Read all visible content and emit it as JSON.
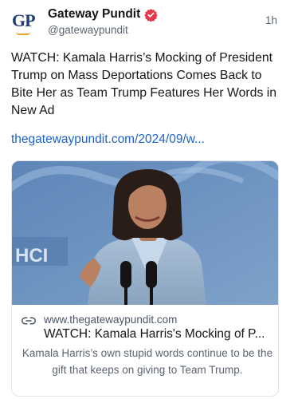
{
  "post": {
    "author_name": "Gateway Pundit",
    "author_handle": "@gatewaypundit",
    "time_ago": "1h",
    "avatar_text": "GP",
    "text": "WATCH: Kamala Harris’s Mocking of President Trump on Mass Deportations Comes Back to Bite Her as Team Trump Features Her Words in New Ad",
    "link_text": "thegatewaypundit.com/2024/09/w..."
  },
  "card": {
    "domain": "www.thegatewaypundit.com",
    "title": "WATCH: Kamala Harris's Mocking of P...",
    "description": "Kamala Harris’s own stupid words continue to be the gift that keeps on giving to Team Trump.",
    "image_alt": "Photo of Kamala Harris speaking at a podium with microphones",
    "backdrop_text": "HCI"
  },
  "colors": {
    "link": "#1d63c9",
    "verified": "#e8374b",
    "avatar_letters": "#1f3b7a",
    "avatar_swoosh": "#e8a32b"
  },
  "icons": [
    "verified-badge-icon",
    "link-icon"
  ]
}
